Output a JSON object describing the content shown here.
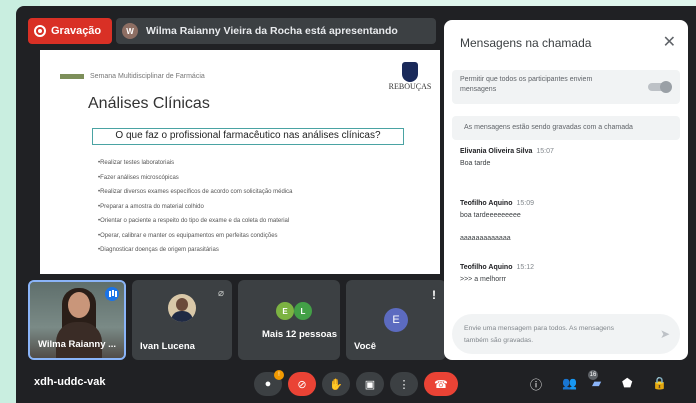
{
  "recording": {
    "label": "Gravação"
  },
  "presenter": {
    "initial": "W",
    "text": "Wilma Raianny Vieira da Rocha está apresentando"
  },
  "slide": {
    "header": "Semana Multidisciplinar de Farmácia",
    "title": "Análises Clínicas",
    "logo": "REBOUÇAS",
    "question": "O que faz o profissional farmacêutico nas análises clínicas?",
    "items": [
      "•Realizar testes laboratoriais",
      "•Fazer análises microscópicas",
      "•Realizar diversos exames específicos de acordo com solicitação médica",
      "•Preparar a amostra do material colhido",
      "•Orientar o paciente a respeito do tipo de exame e da coleta do material",
      "•Operar, calibrar e manter os equipamentos em perfeitas condições",
      "•Diagnosticar doenças de origem parasitárias"
    ]
  },
  "participants": {
    "p1": "Wilma Raianny ...",
    "p2": "Ivan Lucena",
    "p3": "Mais 12 pessoas",
    "p3_initials": [
      "E",
      "L"
    ],
    "p4": "Você",
    "p4_initial": "E"
  },
  "chat": {
    "title": "Mensagens na chamada",
    "allow_text": "Permitir que todos os participantes enviem mensagens",
    "saved_notice": "As mensagens estão sendo gravadas com a chamada",
    "messages": [
      {
        "author": "Elivania Oliveira Silva",
        "time": "15:07",
        "text": "Boa tarde"
      },
      {
        "author": "Teofilho Aquino",
        "time": "15:09",
        "text": "boa tardeeeeeeeee",
        "text2": "aaaaaaaaaaaaa"
      },
      {
        "author": "Teofilho Aquino",
        "time": "15:12",
        "text": ">>> a melhorrr"
      }
    ],
    "input_placeholder": "Envie uma mensagem para todos. As mensagens também são gravadas."
  },
  "meeting_code": "xdh-uddc-vak",
  "people_count": "16",
  "colors": {
    "record": "#d93025",
    "hangup": "#ea4335",
    "accent": "#8ab4f8",
    "background": "#202124"
  }
}
